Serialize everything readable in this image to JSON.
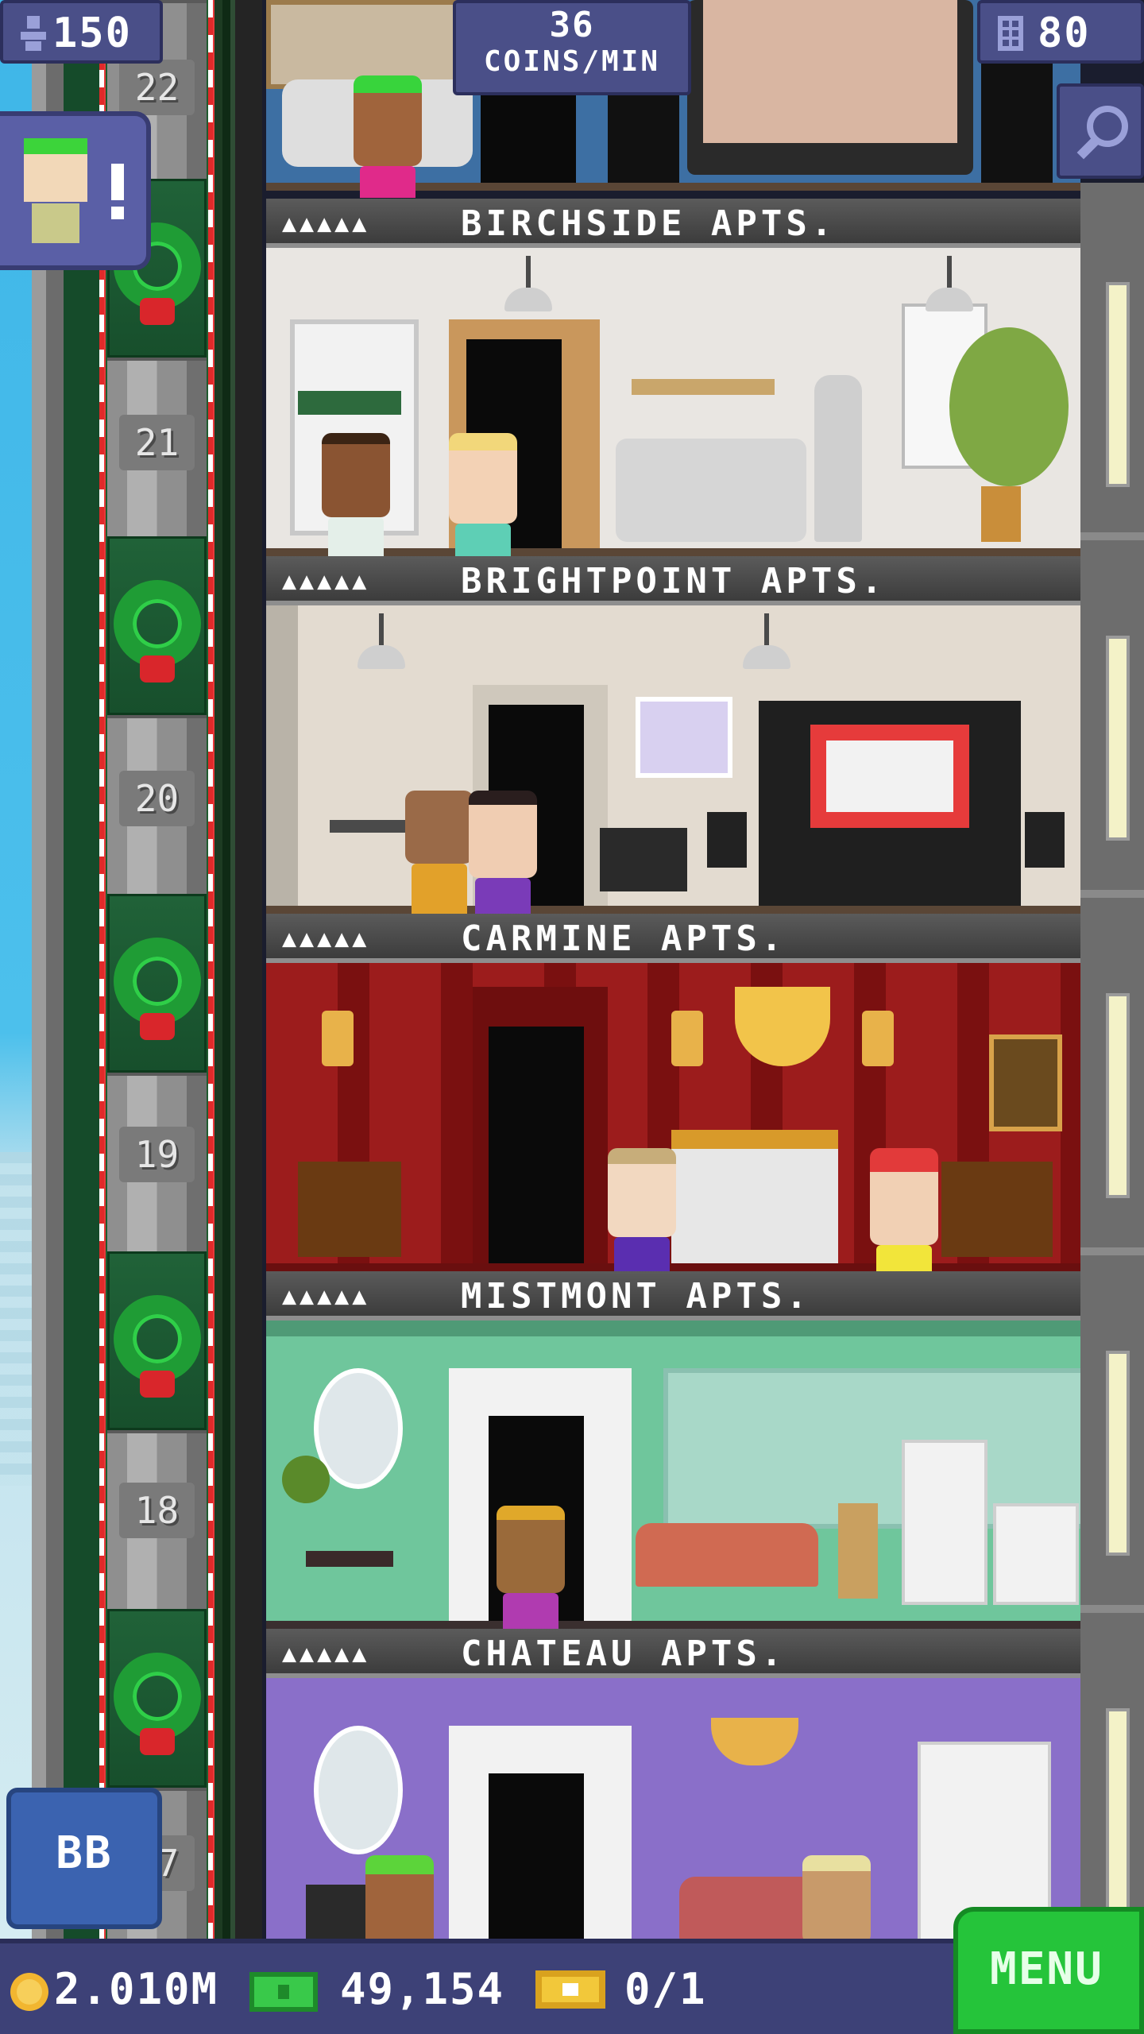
{
  "hud": {
    "population": "150",
    "coins_rate": "36",
    "coins_rate_unit": "COINS/MIN",
    "floor_count": "80",
    "bb_label": "BB"
  },
  "elevator": {
    "floor_numbers": [
      "22",
      "21",
      "20",
      "19",
      "18",
      "17"
    ]
  },
  "floors": [
    {
      "name": "BIRCHSIDE APTS.",
      "occupants": "▲▲▲▲▲"
    },
    {
      "name": "BRIGHTPOINT APTS.",
      "occupants": "▲▲▲▲▲"
    },
    {
      "name": "CARMINE APTS.",
      "occupants": "▲▲▲▲▲"
    },
    {
      "name": "MISTMONT APTS.",
      "occupants": "▲▲▲▲▲"
    },
    {
      "name": "CHATEAU APTS.",
      "occupants": "▲▲▲▲▲"
    }
  ],
  "bottom_bar": {
    "coins": "2.010M",
    "bux": "49,154",
    "tickets": "0/1",
    "menu_label": "MENU"
  },
  "colors": {
    "hud_bg": "#4a4f88",
    "menu_green": "#25c43a",
    "birchside_wall": "#e9e6e2",
    "brightpoint_wall": "#e3dbd0",
    "carmine_wall": "#9c1c1c",
    "mistmont_wall": "#6fc69c",
    "chateau_wall": "#8a6fc9"
  },
  "icons": {
    "population": "person-icon",
    "floors": "building-icon",
    "search": "magnifier-icon",
    "coin": "coin-icon",
    "bux": "banknote-icon",
    "ticket": "ticket-icon"
  }
}
